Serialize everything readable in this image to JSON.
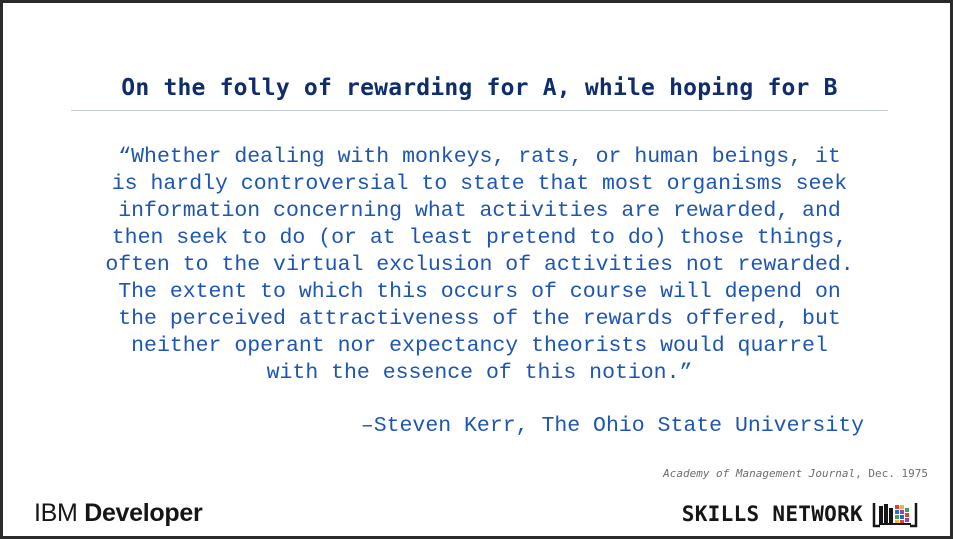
{
  "slide": {
    "title": "On the folly of rewarding for A, while hoping for B",
    "quote_lines": [
      "“Whether dealing with monkeys, rats, or human beings, it",
      "is hardly controversial to state that most organisms seek",
      "information concerning what activities are rewarded, and",
      "then seek to do (or at least pretend to do) those things,",
      "often to the virtual exclusion of activities not rewarded.",
      "The extent to which this occurs of course will depend on",
      "the perceived attractiveness of the rewards offered, but",
      "neither operant nor expectancy theorists would quarrel",
      "with the essence of this notion.”"
    ],
    "attribution": "–Steven Kerr, The Ohio State University",
    "citation": {
      "journal": "Academy of Management Journal",
      "date": ", Dec. 1975"
    }
  },
  "footer": {
    "ibm_logo": {
      "ibm": "IBM",
      "developer": "Developer"
    },
    "skills_network": {
      "text": "SKILLS NETWORK",
      "icon": "skills-network-books-icon"
    }
  },
  "colors": {
    "title": "#0f2d6b",
    "quote": "#1d55b4",
    "citation": "#6d6d6d",
    "border": "#2b2b2b"
  }
}
